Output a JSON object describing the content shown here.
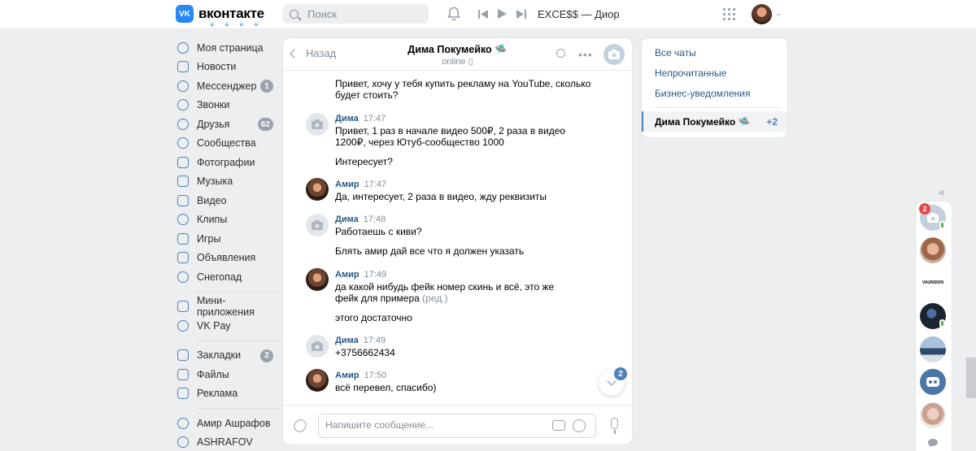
{
  "header": {
    "logo_mark": "VK",
    "logo_text": "вконтакте",
    "search_placeholder": "Поиск",
    "now_playing": "EXCE$$ — Диор",
    "icons": [
      "vk-logo-icon",
      "search-icon",
      "bell-icon",
      "prev-track-icon",
      "play-icon",
      "next-track-icon",
      "apps-grid-icon",
      "chevron-down-icon"
    ]
  },
  "sidebar": {
    "items": [
      {
        "label": "Моя страница",
        "icon": "user-icon"
      },
      {
        "label": "Новости",
        "icon": "news-icon"
      },
      {
        "label": "Мессенджер",
        "icon": "message-icon",
        "badge": "1"
      },
      {
        "label": "Звонки",
        "icon": "phone-icon"
      },
      {
        "label": "Друзья",
        "icon": "friends-icon",
        "badge": "62"
      },
      {
        "label": "Сообщества",
        "icon": "communities-icon"
      },
      {
        "label": "Фотографии",
        "icon": "photo-icon"
      },
      {
        "label": "Музыка",
        "icon": "music-icon"
      },
      {
        "label": "Видео",
        "icon": "video-icon"
      },
      {
        "label": "Клипы",
        "icon": "clips-icon"
      },
      {
        "label": "Игры",
        "icon": "games-icon"
      },
      {
        "label": "Объявления",
        "icon": "classifieds-icon"
      },
      {
        "label": "Снегопад",
        "icon": "snowflake-icon"
      }
    ],
    "group2": [
      {
        "label": "Мини-приложения",
        "icon": "mini-apps-icon"
      },
      {
        "label": "VK Pay",
        "icon": "vk-pay-icon"
      }
    ],
    "group3": [
      {
        "label": "Закладки",
        "icon": "bookmark-icon",
        "badge": "2"
      },
      {
        "label": "Файлы",
        "icon": "files-icon"
      },
      {
        "label": "Реклама",
        "icon": "ads-icon"
      }
    ],
    "group4": [
      {
        "label": "Амир Ашрафов",
        "icon": "communities-icon"
      },
      {
        "label": "ASHRAFOV",
        "icon": "communities-icon"
      }
    ]
  },
  "chat": {
    "back_label": "Назад",
    "peer_name": "Дима Покумейко 🛸",
    "peer_status": "online ▯",
    "messages": [
      {
        "author": "",
        "time": "",
        "avatar": "none",
        "text": "Привет, хочу у тебя купить рекламу на YouTube, сколько будет стоить?"
      },
      {
        "author": "Дима",
        "time": "17:47",
        "avatar": "camera",
        "text": "Привет, 1 раз в начале видео 500₽, 2 раза в видео 1200₽, через Ютуб-сообщество 1000"
      },
      {
        "author": "",
        "time": "",
        "avatar": "none",
        "text": "Интересует?"
      },
      {
        "author": "Амир",
        "time": "17:47",
        "avatar": "photo",
        "text": "Да, интересует, 2 раза в видео, жду реквизиты"
      },
      {
        "author": "Дима",
        "time": "17:48",
        "avatar": "camera",
        "text": "Работаешь с киви?"
      },
      {
        "author": "",
        "time": "",
        "avatar": "none",
        "text": "Блять амир дай все что я должен указать"
      },
      {
        "author": "Амир",
        "time": "17:49",
        "avatar": "photo",
        "text": "да какой нибудь фейк номер скинь и всё, это же фейк для примера",
        "edited": "(ред.)"
      },
      {
        "author": "",
        "time": "",
        "avatar": "none",
        "text": "этого достаточно"
      },
      {
        "author": "Дима",
        "time": "17:49",
        "avatar": "camera",
        "text": "+3756662434"
      },
      {
        "author": "Амир",
        "time": "17:50",
        "avatar": "photo",
        "text": "всё перевел, спасибо)"
      }
    ],
    "unread_badge": "2",
    "composer_placeholder": "Напишите сообщение..."
  },
  "folders": {
    "items": [
      "Все чаты",
      "Непрочитанные",
      "Бизнес-уведомления"
    ],
    "active_chat": {
      "name": "Дима Покумейко 🛸",
      "count": "+2"
    }
  },
  "rail": {
    "collapse_glyph": "«",
    "first_badge": "2",
    "logo_text": "VAUNSION"
  },
  "colors": {
    "accent": "#5181b8",
    "link": "#2a5885",
    "vk_blue": "#2787f5",
    "badge_red": "#e64646",
    "online": "#4bb34b"
  }
}
